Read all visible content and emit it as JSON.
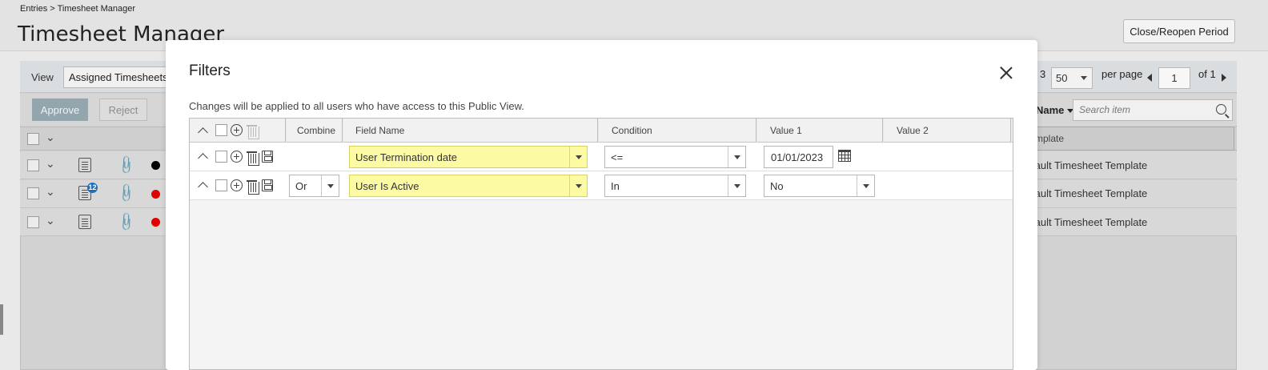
{
  "breadcrumb": "Entries > Timesheet Manager",
  "page_title": "Timesheet Manager",
  "close_reopen_label": "Close/Reopen Period",
  "view": {
    "label": "View",
    "selected": "Assigned Timesheets"
  },
  "actions": {
    "approve": "Approve",
    "reject": "Reject"
  },
  "pager": {
    "count_fragment": "3",
    "per_page_value": "50",
    "per_page_label": "per page",
    "page": "1",
    "of_label": "of 1"
  },
  "name_column": {
    "label": "Name",
    "search_placeholder": "Search item"
  },
  "template_column": {
    "header_fragment": "mplate",
    "cells": [
      "fault Timesheet Template",
      "fault Timesheet Template",
      "fault Timesheet Template"
    ]
  },
  "rows_status_colors": [
    "#000000",
    "#e00000",
    "#e00000"
  ],
  "row_badge": "12",
  "colors": {
    "highlight_field": "#fdfaa4",
    "approve_button": "#93a6ae",
    "badge": "#1f6fb8"
  },
  "filters_modal": {
    "title": "Filters",
    "note": "Changes will be applied to all users who have access to this Public View.",
    "columns": {
      "combine": "Combine",
      "field_name": "Field Name",
      "condition": "Condition",
      "value1": "Value 1",
      "value2": "Value 2"
    },
    "rows": [
      {
        "combine": "",
        "field_name": "User Termination date",
        "condition": "<=",
        "value1": "01/01/2023",
        "value2": ""
      },
      {
        "combine": "Or",
        "field_name": "User Is Active",
        "condition": "In",
        "value1": "No",
        "value2": ""
      }
    ]
  }
}
